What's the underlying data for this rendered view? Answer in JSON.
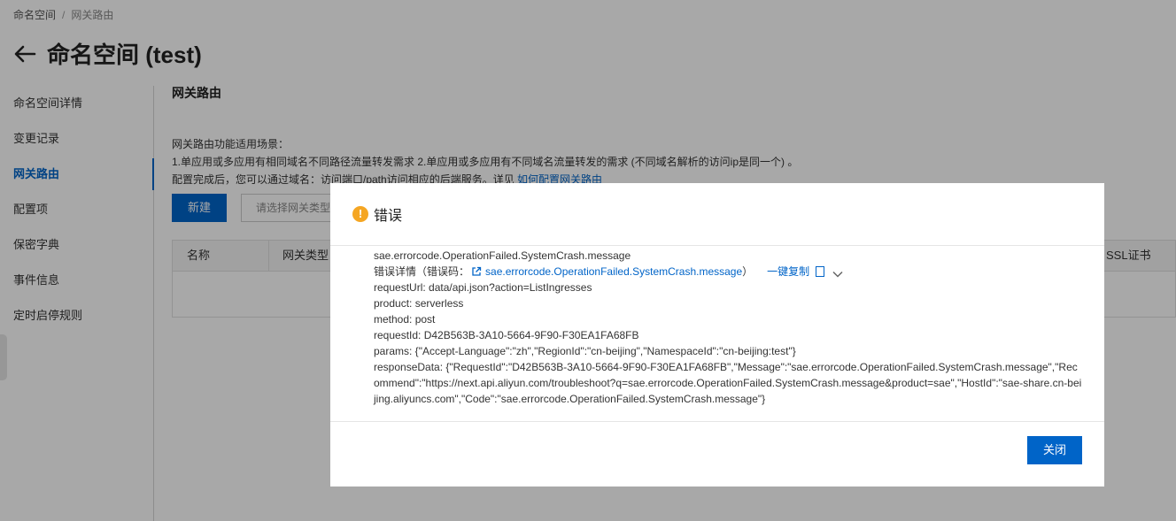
{
  "breadcrumb": {
    "root": "命名空间",
    "separator": "/",
    "current": "网关路由"
  },
  "header": {
    "title": "命名空间 (test)"
  },
  "sidebar": {
    "items": [
      {
        "label": "命名空间详情",
        "active": false
      },
      {
        "label": "变更记录",
        "active": false
      },
      {
        "label": "网关路由",
        "active": true
      },
      {
        "label": "配置项",
        "active": false
      },
      {
        "label": "保密字典",
        "active": false
      },
      {
        "label": "事件信息",
        "active": false
      },
      {
        "label": "定时启停规则",
        "active": false
      }
    ]
  },
  "content": {
    "section_title": "网关路由",
    "desc_line1": "网关路由功能适用场景：",
    "desc_line2": "1.单应用或多应用有相同域名不同路径流量转发需求 2.单应用或多应用有不同域名流量转发的需求 (不同域名解析的访问ip是同一个) 。",
    "desc_line3": "配置完成后，您可以通过域名：访问端口/path访问相应的后端服务。详见",
    "desc_link": "如何配置网关路由",
    "new_button": "新建",
    "type_select_placeholder": "请选择网关类型",
    "table_headers": {
      "name": "名称",
      "type": "网关类型",
      "ssl": "SSL证书"
    }
  },
  "dialog": {
    "title": "错误",
    "message": "sae.errorcode.OperationFailed.SystemCrash.message",
    "detail_label": "错误详情（错误码：",
    "detail_code": "sae.errorcode.OperationFailed.SystemCrash.message",
    "detail_close": "）",
    "copy_label": "一键复制",
    "request_url": "requestUrl: data/api.json?action=ListIngresses",
    "product": "product: serverless",
    "method": "method: post",
    "request_id": "requestId: D42B563B-3A10-5664-9F90-F30EA1FA68FB",
    "params": "params: {\"Accept-Language\":\"zh\",\"RegionId\":\"cn-beijing\",\"NamespaceId\":\"cn-beijing:test\"}",
    "response_data": "responseData: {\"RequestId\":\"D42B563B-3A10-5664-9F90-F30EA1FA68FB\",\"Message\":\"sae.errorcode.OperationFailed.SystemCrash.message\",\"Recommend\":\"https://next.api.aliyun.com/troubleshoot?q=sae.errorcode.OperationFailed.SystemCrash.message&product=sae\",\"HostId\":\"sae-share.cn-beijing.aliyuncs.com\",\"Code\":\"sae.errorcode.OperationFailed.SystemCrash.message\"}",
    "close_button": "关闭"
  },
  "colors": {
    "primary": "#0064c8",
    "warning": "#f5a623",
    "overlay": "rgba(0,0,0,0.34)"
  }
}
